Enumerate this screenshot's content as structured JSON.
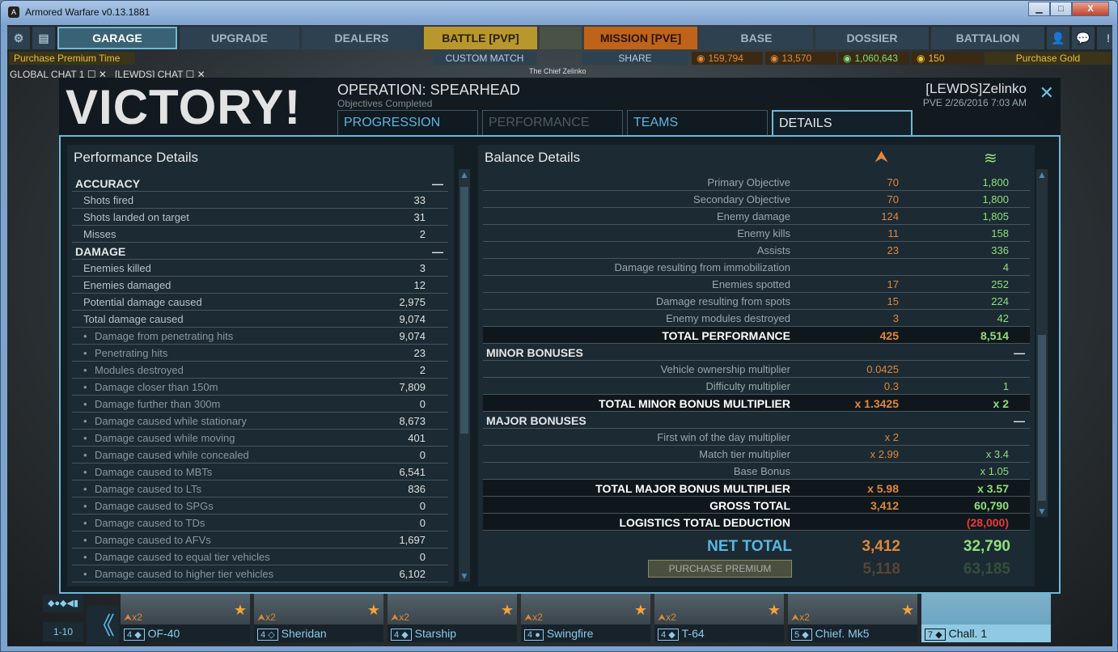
{
  "window": {
    "title": "Armored Warfare v0.13.1881",
    "min": "▁",
    "max": "□",
    "close": "X"
  },
  "nav": {
    "items": [
      "GARAGE",
      "UPGRADE",
      "DEALERS",
      "BATTLE [PVP]",
      "MISSION [PVE]",
      "BASE",
      "DOSSIER",
      "BATTALION"
    ],
    "tank_caption": "The Chief Zelinko",
    "purchase_premium_time": "Purchase Premium Time",
    "custom_match": "CUSTOM MATCH",
    "share": "SHARE",
    "currencies": [
      {
        "icon": "rep-icon",
        "value": "159,794",
        "color": "#e08a3a"
      },
      {
        "icon": "commander-xp-icon",
        "value": "13,570",
        "color": "#e08a3a"
      },
      {
        "icon": "credits-icon",
        "value": "1,060,643",
        "color": "#7fe07f"
      },
      {
        "icon": "gold-icon",
        "value": "150",
        "color": "#e8c040"
      }
    ],
    "purchase_gold": "Purchase Gold"
  },
  "chat": {
    "global": "GLOBAL CHAT 1",
    "clan": "[LEWDS] CHAT"
  },
  "result": {
    "title": "VICTORY!",
    "operation": "OPERATION: SPEARHEAD",
    "status": "Objectives Completed",
    "player": "[LEWDS]Zelinko",
    "meta": "PVE 2/26/2016 7:03 AM",
    "tabs": [
      "PROGRESSION",
      "PERFORMANCE",
      "TEAMS",
      "DETAILS"
    ],
    "active_tab": "DETAILS"
  },
  "performance": {
    "title": "Performance Details",
    "sections": [
      {
        "name": "ACCURACY",
        "rows": [
          [
            "Shots fired",
            "33",
            0
          ],
          [
            "Shots landed on target",
            "31",
            0
          ],
          [
            "Misses",
            "2",
            0
          ]
        ]
      },
      {
        "name": "DAMAGE",
        "rows": [
          [
            "Enemies killed",
            "3",
            0
          ],
          [
            "Enemies damaged",
            "12",
            0
          ],
          [
            "Potential damage caused",
            "2,975",
            0
          ],
          [
            "Total damage caused",
            "9,074",
            0
          ],
          [
            "Damage from penetrating hits",
            "9,074",
            1
          ],
          [
            "Penetrating hits",
            "23",
            1
          ],
          [
            "Modules destroyed",
            "2",
            1
          ],
          [
            "Damage closer than 150m",
            "7,809",
            1
          ],
          [
            "Damage further than 300m",
            "0",
            1
          ],
          [
            "Damage caused while stationary",
            "8,673",
            1
          ],
          [
            "Damage caused while moving",
            "401",
            1
          ],
          [
            "Damage caused while concealed",
            "0",
            1
          ],
          [
            "Damage caused to MBTs",
            "6,541",
            1
          ],
          [
            "Damage caused to LTs",
            "836",
            1
          ],
          [
            "Damage caused to SPGs",
            "0",
            1
          ],
          [
            "Damage caused to TDs",
            "0",
            1
          ],
          [
            "Damage caused to AFVs",
            "1,697",
            1
          ],
          [
            "Damage caused to equal tier vehicles",
            "0",
            1
          ],
          [
            "Damage caused to higher tier vehicles",
            "6,102",
            1
          ]
        ]
      }
    ]
  },
  "balance": {
    "title": "Balance Details",
    "colors": {
      "rep": "#e0883a",
      "credits": "#8fe07a",
      "deduction": "#e83a3a",
      "net": "#5bb6e0"
    },
    "rows": [
      {
        "t": "r",
        "label": "Primary Objective",
        "rep": "70",
        "cr": "1,800"
      },
      {
        "t": "r",
        "label": "Secondary Objective",
        "rep": "70",
        "cr": "1,800"
      },
      {
        "t": "r",
        "label": "Enemy damage",
        "rep": "124",
        "cr": "1,805"
      },
      {
        "t": "r",
        "label": "Enemy kills",
        "rep": "11",
        "cr": "158"
      },
      {
        "t": "r",
        "label": "Assists",
        "rep": "23",
        "cr": "336"
      },
      {
        "t": "r",
        "label": "Damage resulting from immobilization",
        "rep": "",
        "cr": "4"
      },
      {
        "t": "r",
        "label": "Enemies spotted",
        "rep": "17",
        "cr": "252"
      },
      {
        "t": "r",
        "label": "Damage resulting from spots",
        "rep": "15",
        "cr": "224"
      },
      {
        "t": "r",
        "label": "Enemy modules destroyed",
        "rep": "3",
        "cr": "42"
      },
      {
        "t": "total",
        "label": "TOTAL PERFORMANCE",
        "rep": "425",
        "cr": "8,514"
      },
      {
        "t": "sec",
        "label": "MINOR BONUSES"
      },
      {
        "t": "r",
        "label": "Vehicle ownership multiplier",
        "rep": "0.0425",
        "cr": ""
      },
      {
        "t": "r",
        "label": "Difficulty multiplier",
        "rep": "0.3",
        "cr": "1"
      },
      {
        "t": "total",
        "label": "TOTAL MINOR BONUS MULTIPLIER",
        "rep": "x 1.3425",
        "cr": "x 2"
      },
      {
        "t": "sec",
        "label": "MAJOR BONUSES"
      },
      {
        "t": "r",
        "label": "First win of the day multiplier",
        "rep": "x 2",
        "cr": ""
      },
      {
        "t": "r",
        "label": "Match tier multiplier",
        "rep": "x 2.99",
        "cr": "x 3.4"
      },
      {
        "t": "r",
        "label": "Base Bonus",
        "rep": "",
        "cr": "x 1.05"
      },
      {
        "t": "total",
        "label": "TOTAL MAJOR BONUS MULTIPLIER",
        "rep": "x 5.98",
        "cr": "x 3.57"
      },
      {
        "t": "total",
        "label": "GROSS TOTAL",
        "rep": "3,412",
        "cr": "60,790"
      },
      {
        "t": "ded",
        "label": "LOGISTICS TOTAL DEDUCTION",
        "rep": "",
        "cr": "(28,000)"
      }
    ],
    "net_label": "NET TOTAL",
    "net_rep": "3,412",
    "net_cr": "32,790",
    "purchase_premium": "PURCHASE PREMIUM",
    "premium_rep": "5,118",
    "premium_cr": "63,185"
  },
  "carousel": {
    "filter_range": "1-10",
    "vehicles": [
      {
        "tier": "4",
        "cls": "◆",
        "name": "OF-40",
        "mult": "x2"
      },
      {
        "tier": "4",
        "cls": "◇",
        "name": "Sheridan",
        "mult": "x2"
      },
      {
        "tier": "4",
        "cls": "◆",
        "name": "Starship",
        "mult": "x2"
      },
      {
        "tier": "4",
        "cls": "●",
        "name": "Swingfire",
        "mult": "x2"
      },
      {
        "tier": "4",
        "cls": "◆",
        "name": "T-64",
        "mult": "x2"
      },
      {
        "tier": "5",
        "cls": "◆",
        "name": "Chief. Mk5",
        "mult": "x2"
      },
      {
        "tier": "7",
        "cls": "◆",
        "name": "Chall. 1",
        "mult": "",
        "selected": true
      }
    ]
  }
}
